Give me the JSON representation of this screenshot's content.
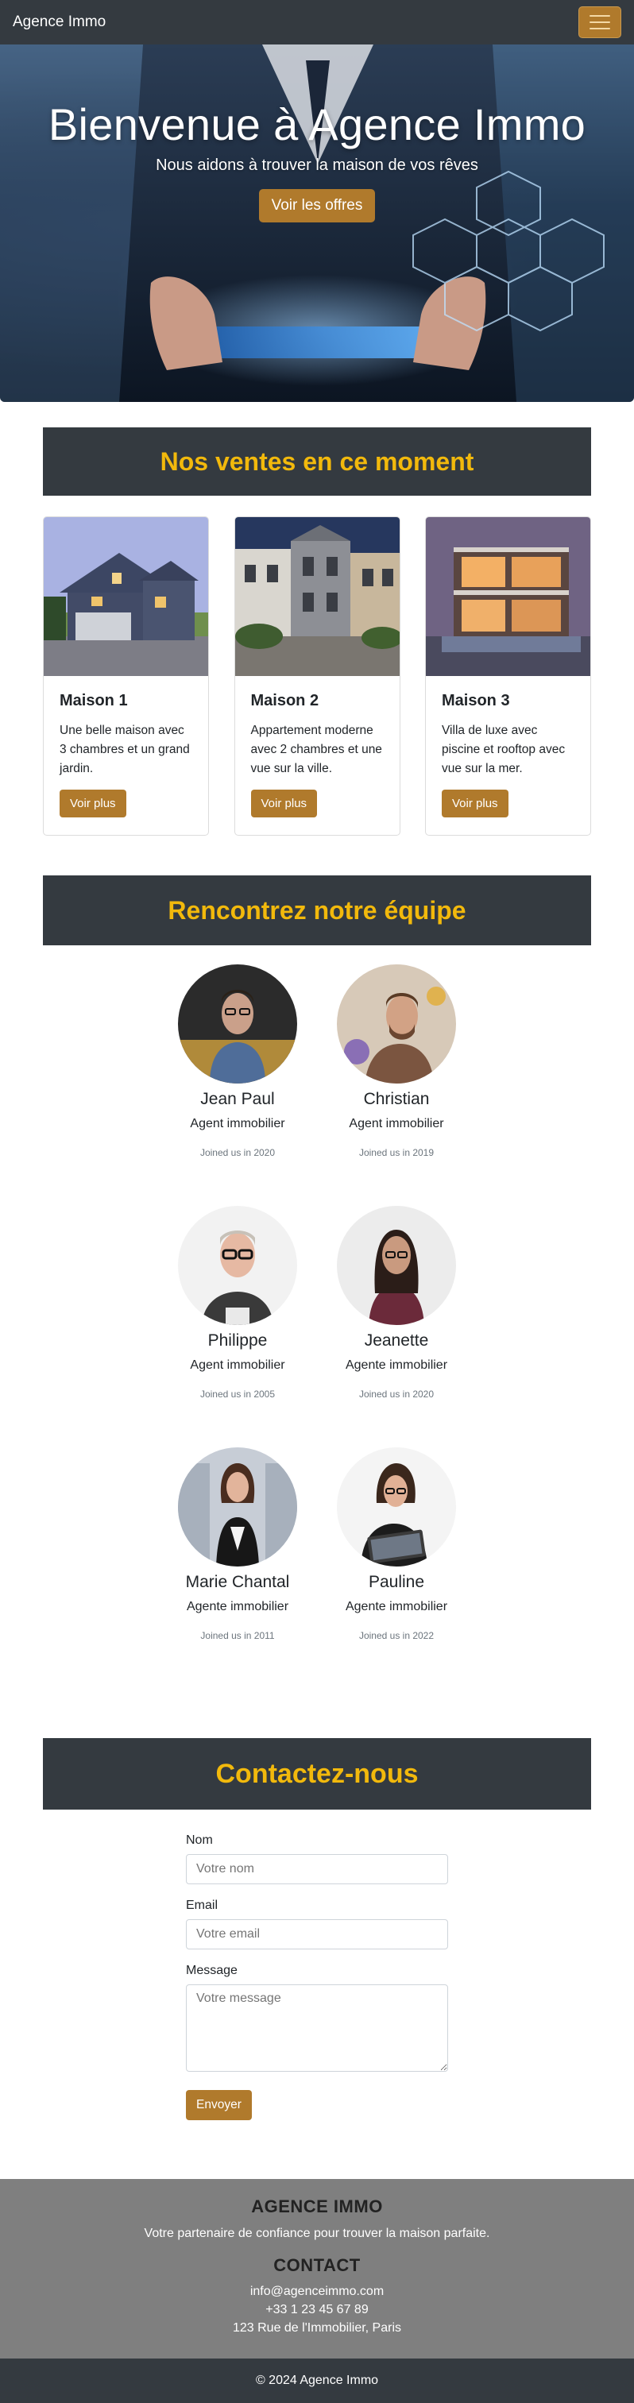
{
  "navbar": {
    "brand": "Agence Immo",
    "toggler_icon": "hamburger-menu-icon"
  },
  "hero": {
    "title": "Bienvenue à Agence Immo",
    "subtitle": "Nous aidons à trouver la maison de vos rêves",
    "button_label": "Voir les offres"
  },
  "listings": {
    "heading": "Nos ventes en ce moment",
    "items": [
      {
        "title": "Maison 1",
        "description": "Une belle maison avec 3 chambres et un grand jardin.",
        "button_label": "Voir plus"
      },
      {
        "title": "Maison 2",
        "description": "Appartement moderne avec 2 chambres et une vue sur la ville.",
        "button_label": "Voir plus"
      },
      {
        "title": "Maison 3",
        "description": "Villa de luxe avec piscine et rooftop avec vue sur la mer.",
        "button_label": "Voir plus"
      }
    ]
  },
  "team": {
    "heading": "Rencontrez notre équipe",
    "members": [
      {
        "name": "Jean Paul",
        "role": "Agent immobilier",
        "joined": "Joined us in 2020"
      },
      {
        "name": "Christian",
        "role": "Agent immobilier",
        "joined": "Joined us in 2019"
      },
      {
        "name": "Philippe",
        "role": "Agent immobilier",
        "joined": "Joined us in 2005"
      },
      {
        "name": "Jeanette",
        "role": "Agente immobilier",
        "joined": "Joined us in 2020"
      },
      {
        "name": "Marie Chantal",
        "role": "Agente immobilier",
        "joined": "Joined us in 2011"
      },
      {
        "name": "Pauline",
        "role": "Agente immobilier",
        "joined": "Joined us in 2022"
      }
    ]
  },
  "contact": {
    "heading": "Contactez-nous",
    "name_label": "Nom",
    "name_placeholder": "Votre nom",
    "email_label": "Email",
    "email_placeholder": "Votre email",
    "message_label": "Message",
    "message_placeholder": "Votre message",
    "submit_label": "Envoyer"
  },
  "footer": {
    "company_heading": "AGENCE IMMO",
    "tagline": "Votre partenaire de confiance pour trouver la maison parfaite.",
    "contact_heading": "CONTACT",
    "email": "info@agenceimmo.com",
    "phone": "+33 1 23 45 67 89",
    "address": "123 Rue de l'Immobilier, Paris",
    "copyright": "© 2024 Agence Immo"
  },
  "colors": {
    "dark": "#343a40",
    "accent": "#b07a2c",
    "heading_gold": "#f2b90c",
    "footer_grey": "#7f7f7f"
  }
}
